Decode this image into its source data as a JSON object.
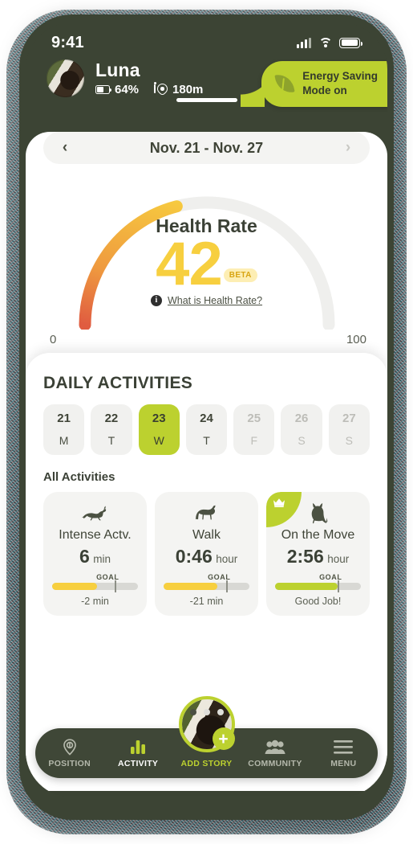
{
  "status_bar": {
    "time": "9:41",
    "signal_icon": "signal-bars-icon",
    "wifi_icon": "wifi-icon",
    "battery_icon": "battery-icon"
  },
  "header": {
    "pet_name": "Luna",
    "battery_value": "64%",
    "distance_value": "180m",
    "eco_line1": "Energy Saving",
    "eco_line2": "Mode on",
    "avatar_alt": "pet-avatar"
  },
  "date_nav": {
    "prev": "‹",
    "next": "›",
    "range": "Nov. 21 - Nov. 27"
  },
  "gauge": {
    "title": "Health Rate",
    "score": "42",
    "beta": "BETA",
    "info_glyph": "i",
    "link": "What is Health Rate?",
    "min": "0",
    "max": "100",
    "colors": {
      "low": "#e05c40",
      "mid": "#f0a23c",
      "high": "#f7cf3f",
      "track": "#efefed"
    }
  },
  "daily": {
    "section_title": "DAILY ACTIVITIES",
    "days": [
      {
        "num": "21",
        "dow": "M",
        "state": "past"
      },
      {
        "num": "22",
        "dow": "T",
        "state": "past"
      },
      {
        "num": "23",
        "dow": "W",
        "state": "selected"
      },
      {
        "num": "24",
        "dow": "T",
        "state": "past"
      },
      {
        "num": "25",
        "dow": "F",
        "state": "future"
      },
      {
        "num": "26",
        "dow": "S",
        "state": "future"
      },
      {
        "num": "27",
        "dow": "S",
        "state": "future"
      }
    ],
    "sub_title": "All Activities",
    "goal_label": "GOAL",
    "cards": [
      {
        "icon": "running-cat-icon",
        "name": "Intense Actv.",
        "value": "6",
        "unit": "min",
        "progress": 52,
        "marker": 73,
        "bar_color": "#f7cf3f",
        "footer": "-2 min",
        "crowned": false
      },
      {
        "icon": "walking-cat-icon",
        "name": "Walk",
        "value": "0:46",
        "unit": "hour",
        "progress": 63,
        "marker": 73,
        "bar_color": "#f7cf3f",
        "footer": "-21 min",
        "crowned": false
      },
      {
        "icon": "sitting-cat-icon",
        "name": "On the Move",
        "value": "2:56",
        "unit": "hour",
        "progress": 73,
        "marker": 73,
        "bar_color": "#bcd12f",
        "footer": "Good Job!",
        "crowned": true,
        "crown_icon": "crown-icon"
      }
    ]
  },
  "pager": {
    "dots": 3,
    "active": 0
  },
  "nav": {
    "items": [
      {
        "label": "POSITION",
        "icon": "location-target-icon",
        "state": "inactive"
      },
      {
        "label": "ACTIVITY",
        "icon": "bar-chart-icon",
        "state": "active"
      },
      {
        "label": "ADD STORY",
        "icon": "add-story-avatar-icon",
        "state": "story"
      },
      {
        "label": "COMMUNITY",
        "icon": "people-group-icon",
        "state": "inactive"
      },
      {
        "label": "MENU",
        "icon": "hamburger-menu-icon",
        "state": "inactive"
      }
    ],
    "plus": "+"
  }
}
